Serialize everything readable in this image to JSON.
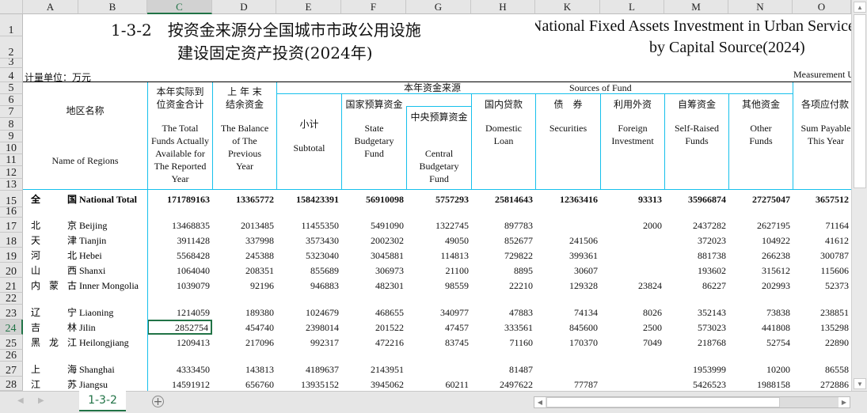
{
  "columns": [
    "A",
    "B",
    "C",
    "D",
    "E",
    "F",
    "G",
    "H",
    "K",
    "L",
    "M",
    "N",
    "O"
  ],
  "row_numbers": [
    "1",
    "2",
    "3",
    "4",
    "5",
    "6",
    "7",
    "8",
    "9",
    "10",
    "11",
    "12",
    "13",
    "15",
    "16",
    "17",
    "18",
    "19",
    "20",
    "21",
    "22",
    "23",
    "24",
    "25",
    "26",
    "27",
    "28"
  ],
  "title": {
    "cn_line1": "1-3-2　按资金来源分全国城市市政公用设施",
    "cn_line2": "建设固定资产投资(2024年)",
    "en_line1": "National Fixed Assets Investment in Urban Service Facilities",
    "en_line2": "by Capital Source(2024)"
  },
  "unit_cn": "计量单位：万元",
  "unit_en": "Measurement Unit",
  "headers": {
    "region_cn": "地区名称",
    "region_en": "Name of Regions",
    "total_cn": "本年实际到\n位资金合计",
    "total_en": "The Total\nFunds Actually\nAvailable for\nThe Reported\nYear",
    "balance_cn": "上 年 末\n结余资金",
    "balance_en": "The Balance\nof The\nPrevious\nYear",
    "source_cn": "本年资金来源",
    "source_en": "Sources of Fund",
    "subtotal_cn": "小计",
    "subtotal_en": "Subtotal",
    "state_cn": "国家预算资金",
    "state_en": "State\nBudgetary\nFund",
    "central_cn": "中央预算资金",
    "central_en": "Central\nBudgetary\nFund",
    "loan_cn": "国内贷款",
    "loan_en": "Domestic\nLoan",
    "securities_cn": "债　券",
    "securities_en": "Securities",
    "foreign_cn": "利用外资",
    "foreign_en": "Foreign\nInvestment",
    "self_cn": "自筹资金",
    "self_en": "Self-Raised\nFunds",
    "other_cn": "其他资金",
    "other_en": "Other\nFunds",
    "payable_cn": "各项应付款",
    "payable_en": "Sum Payable\nThis Year"
  },
  "rows": [
    {
      "cn": "全 国",
      "en": "National Total",
      "bold": true,
      "values": [
        "171789163",
        "13365772",
        "158423391",
        "56910098",
        "5757293",
        "25814643",
        "12363416",
        "93313",
        "35966874",
        "27275047",
        "3657512"
      ]
    },
    null,
    {
      "cn": "北 京",
      "en": "Beijing",
      "values": [
        "13468835",
        "2013485",
        "11455350",
        "5491090",
        "1322745",
        "897783",
        "",
        "2000",
        "2437282",
        "2627195",
        "71164"
      ]
    },
    {
      "cn": "天 津",
      "en": "Tianjin",
      "values": [
        "3911428",
        "337998",
        "3573430",
        "2002302",
        "49050",
        "852677",
        "241506",
        "",
        "372023",
        "104922",
        "41612"
      ]
    },
    {
      "cn": "河 北",
      "en": "Hebei",
      "values": [
        "5568428",
        "245388",
        "5323040",
        "3045881",
        "114813",
        "729822",
        "399361",
        "",
        "881738",
        "266238",
        "300787"
      ]
    },
    {
      "cn": "山 西",
      "en": "Shanxi",
      "values": [
        "1064040",
        "208351",
        "855689",
        "306973",
        "21100",
        "8895",
        "30607",
        "",
        "193602",
        "315612",
        "115606"
      ]
    },
    {
      "cn": "内 蒙 古",
      "en": "Inner Mongolia",
      "values": [
        "1039079",
        "92196",
        "946883",
        "482301",
        "98559",
        "22210",
        "129328",
        "23824",
        "86227",
        "202993",
        "52373"
      ]
    },
    null,
    {
      "cn": "辽 宁",
      "en": "Liaoning",
      "values": [
        "1214059",
        "189380",
        "1024679",
        "468655",
        "340977",
        "47883",
        "74134",
        "8026",
        "352143",
        "73838",
        "238851"
      ]
    },
    {
      "cn": "吉 林",
      "en": "Jilin",
      "values": [
        "2852754",
        "454740",
        "2398014",
        "201522",
        "47457",
        "333561",
        "845600",
        "2500",
        "573023",
        "441808",
        "135298"
      ]
    },
    {
      "cn": "黑 龙 江",
      "en": "Heilongjiang",
      "values": [
        "1209413",
        "217096",
        "992317",
        "472216",
        "83745",
        "71160",
        "170370",
        "7049",
        "218768",
        "52754",
        "22890"
      ]
    },
    null,
    {
      "cn": "上 海",
      "en": "Shanghai",
      "values": [
        "4333450",
        "143813",
        "4189637",
        "2143951",
        "",
        "81487",
        "",
        "",
        "1953999",
        "10200",
        "86558"
      ]
    },
    {
      "cn": "江 苏",
      "en": "Jiangsu",
      "values": [
        "14591912",
        "656760",
        "13935152",
        "3945062",
        "60211",
        "2497622",
        "77787",
        "",
        "5426523",
        "1988158",
        "272886"
      ]
    }
  ],
  "sheet_tab": "1-3-2",
  "colors": {
    "accent": "#217346",
    "border": "#16c0ec"
  }
}
